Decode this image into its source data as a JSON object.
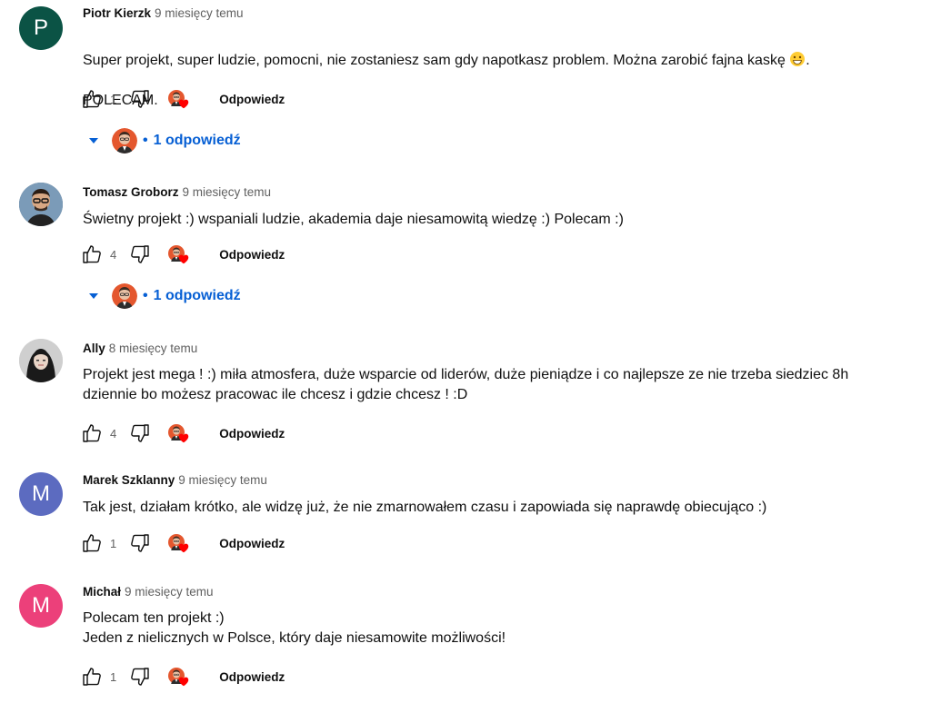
{
  "comments": [
    {
      "author": "Piotr Kierzk",
      "time": "9 miesięcy temu",
      "avatar_letter": "P",
      "avatar_color": "#0b5345",
      "text_line1": "Super projekt, super ludzie, pomocni, nie zostaniesz sam gdy napotkasz problem. Można zarobić fajna kaskę ",
      "text_line1_end": ".",
      "text_line2": "POLECAM.",
      "likes": "1",
      "reply_label": "Odpowiedz",
      "replies_label": "1 odpowiedź"
    },
    {
      "author": "Tomasz Groborz",
      "time": "9 miesięcy temu",
      "text": "Świetny projekt :) wspaniali ludzie, akademia daje niesamowitą wiedzę :) Polecam :)",
      "likes": "4",
      "reply_label": "Odpowiedz",
      "replies_label": "1 odpowiedź"
    },
    {
      "author": "Ally",
      "time": "8 miesięcy temu",
      "text": "Projekt jest mega ! :) miła atmosfera, duże wsparcie od liderów,  duże pieniądze i co najlepsze ze nie trzeba siedziec 8h\ndziennie bo możesz pracowac ile chcesz i gdzie chcesz ! :D",
      "likes": "4",
      "reply_label": "Odpowiedz"
    },
    {
      "author": "Marek Szklanny",
      "time": "9 miesięcy temu",
      "avatar_letter": "M",
      "avatar_color": "#5c6bc0",
      "text": "Tak jest, działam krótko, ale widzę już, że nie zmarnowałem czasu i zapowiada się naprawdę obiecująco :)",
      "likes": "1",
      "reply_label": "Odpowiedz"
    },
    {
      "author": "Michał",
      "time": "9 miesięcy temu",
      "avatar_letter": "M",
      "avatar_color": "#ec407a",
      "text": "Polecam ten projekt :)\nJeden z nielicznych w Polsce, który daje niesamowite możliwości!",
      "likes": "1",
      "reply_label": "Odpowiedz"
    }
  ],
  "colors": {
    "link_blue": "#065fd4",
    "heart_red": "#ff0000",
    "secondary_text": "#606060"
  },
  "icons": [
    "thumb-up-icon",
    "thumb-down-icon",
    "creator-heart-icon",
    "caret-down-icon",
    "grinning-emoji-icon"
  ]
}
